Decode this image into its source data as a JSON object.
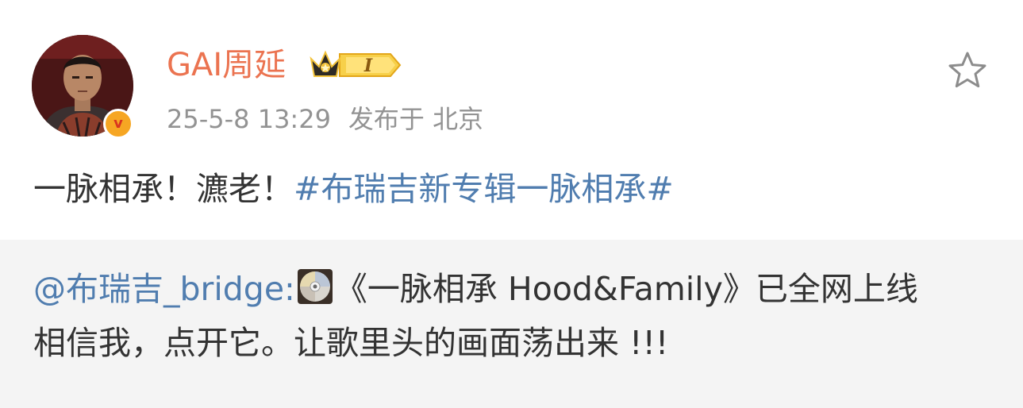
{
  "post": {
    "author": {
      "name": "GAI周延",
      "avatar_icon": "avatar-photo",
      "verified_icon": "verified-v-icon",
      "verified_mark": "v",
      "member_badge_icon": "crown-member-badge",
      "member_badge_text": "I"
    },
    "meta": {
      "time": "25-5-8 13:29",
      "location": "发布于 北京"
    },
    "favorite_icon": "star-icon",
    "content": {
      "text": "一脉相承！瀌老！",
      "hashtag": "#布瑞吉新专辑一脉相承#"
    },
    "repost": {
      "mention": "@布瑞吉_bridge:",
      "cd_icon": "cd-icon",
      "line1_text": "《一脉相承 Hood&Family》已全网上线",
      "line2_text": "相信我，点开它。让歌里头的画面荡出来 !!!"
    }
  },
  "colors": {
    "username": "#eb7350",
    "link": "#507daf",
    "meta": "#939393",
    "text": "#333333",
    "repost_bg": "#f4f4f4",
    "verified": "#f6a623"
  }
}
